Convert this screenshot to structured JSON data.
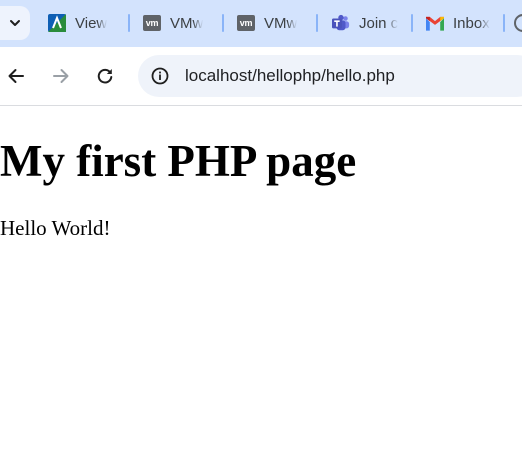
{
  "browser": {
    "tabs": [
      {
        "title": "View",
        "icon": "app-logo-icon"
      },
      {
        "title": "VMw",
        "icon": "vmware-icon"
      },
      {
        "title": "VMw",
        "icon": "vmware-icon"
      },
      {
        "title": "Join c",
        "icon": "teams-icon"
      },
      {
        "title": "Inbox",
        "icon": "gmail-icon"
      }
    ],
    "address_bar": {
      "url": "localhost/hellophp/hello.php"
    },
    "vm_badge": "vm"
  },
  "page": {
    "heading": "My first PHP page",
    "paragraph": "Hello World!"
  },
  "colors": {
    "tabstrip_bg": "#d3e3fd",
    "omnibox_bg": "#eff3fa",
    "separator": "#8ab4f8"
  }
}
